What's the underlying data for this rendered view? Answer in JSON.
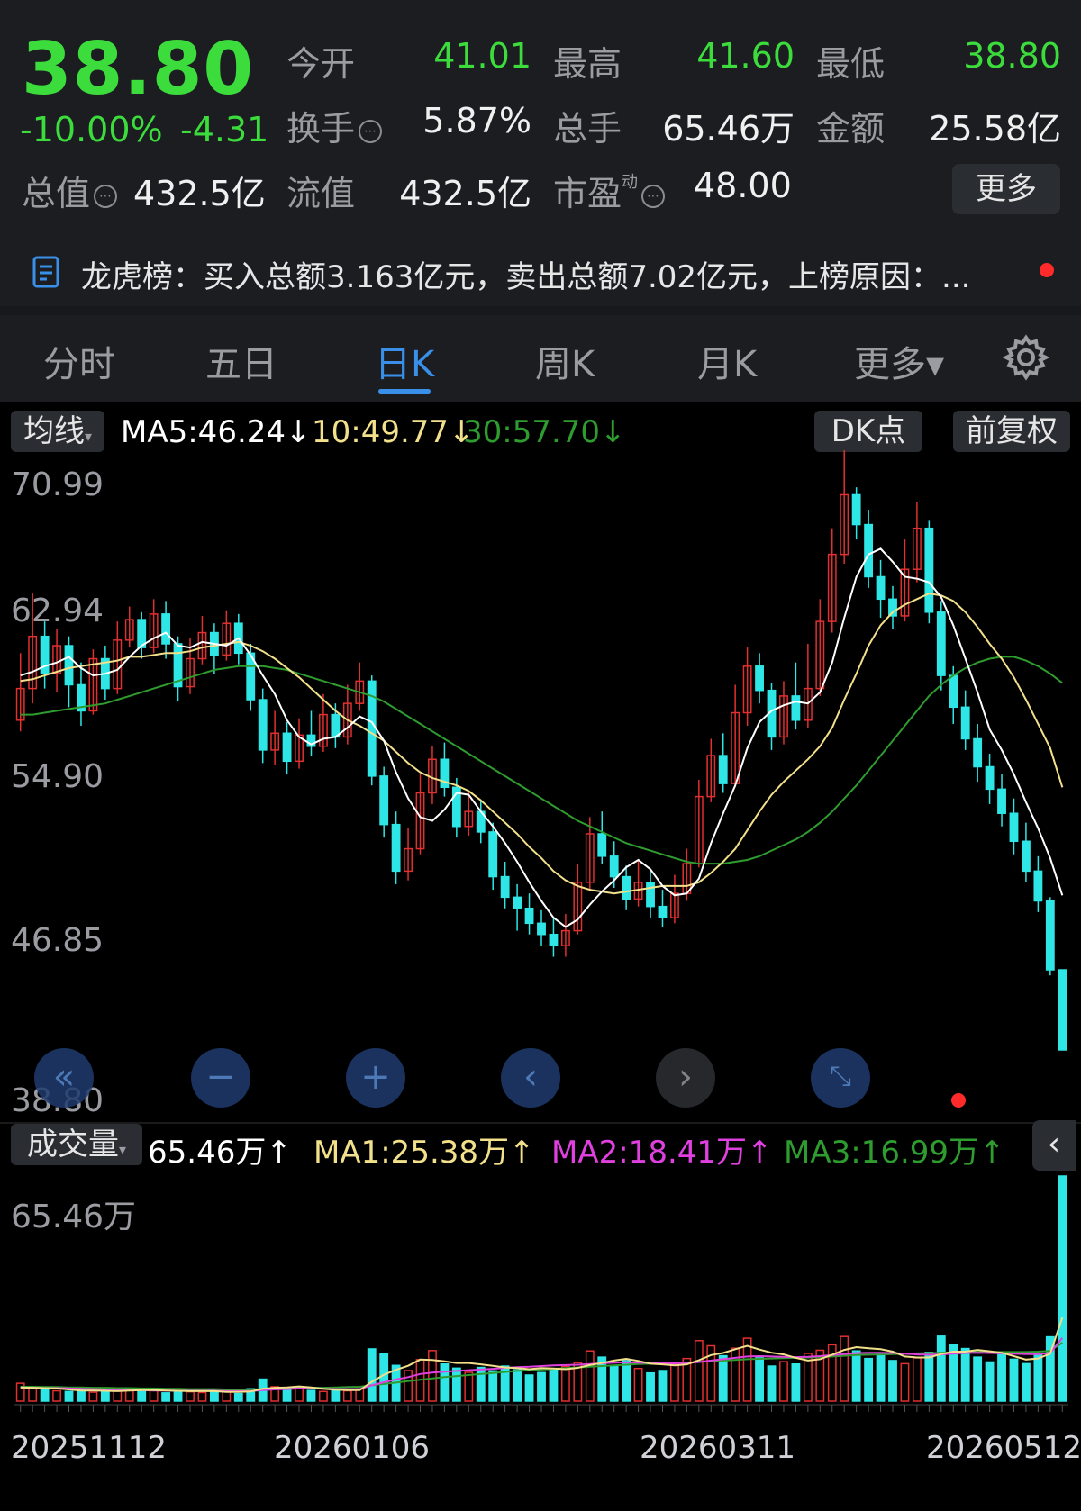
{
  "quote": {
    "price": "38.80",
    "change_pct": "-10.00%",
    "change_amt": "-4.31",
    "rows": [
      [
        {
          "label": "今开",
          "value": "41.01",
          "green": true
        },
        {
          "label": "最高",
          "value": "41.60",
          "green": true
        },
        {
          "label": "最低",
          "value": "38.80",
          "green": true
        }
      ],
      [
        {
          "label": "换手",
          "value": "5.87%"
        },
        {
          "label": "总手",
          "value": "65.46万"
        },
        {
          "label": "金额",
          "value": "25.58亿"
        }
      ]
    ],
    "row3": {
      "l1": "总值",
      "v1": "432.5亿",
      "l2": "流值",
      "v2": "432.5亿",
      "l3": "市盈",
      "l3_sup": "动",
      "v3": "48.00"
    },
    "more_label": "更多",
    "info_glyph": "⋯"
  },
  "notice": {
    "icon": "document-icon",
    "text": "龙虎榜：买入总额3.163亿元，卖出总额7.02亿元，上榜原因：...",
    "dot_color": "#ff2a2a"
  },
  "tabs": [
    {
      "label": "分时"
    },
    {
      "label": "五日"
    },
    {
      "label": "日K",
      "active": true
    },
    {
      "label": "周K"
    },
    {
      "label": "月K"
    },
    {
      "label": "更多▾"
    }
  ],
  "ma_bar": {
    "selector": "均线",
    "ma5": "MA5:46.24",
    "ma10": "10:49.77",
    "ma30": "30:57.70",
    "arrow": "↓",
    "dk": "DK点",
    "fq": "前复权"
  },
  "price_axis": [
    "70.99",
    "62.94",
    "54.90",
    "46.85",
    "38.80"
  ],
  "vol_bar": {
    "selector": "成交量",
    "vol": "65.46万",
    "ma1": "MA1:25.38万",
    "ma2": "MA2:18.41万",
    "ma3": "MA3:16.99万",
    "arrow": "↑",
    "max_label": "65.46万"
  },
  "dates": [
    "20251112",
    "20260106",
    "20260311",
    "20260512"
  ],
  "colors": {
    "up": "#e03030",
    "down": "#2ee6e6",
    "ma5": "#ffffff",
    "ma10": "#f2e08a",
    "ma30": "#2e9c2e",
    "vma1": "#f2e08a",
    "vma2": "#e040e0",
    "vma3": "#2e9c2e"
  },
  "chart_data": {
    "type": "candlestick",
    "ylim": [
      38.8,
      70.99
    ],
    "candles": [
      [
        56.5,
        58.2,
        60.1,
        55.9
      ],
      [
        58.2,
        61.0,
        63.3,
        57.4
      ],
      [
        61.0,
        59.0,
        61.8,
        58.2
      ],
      [
        59.0,
        60.5,
        61.4,
        58.0
      ],
      [
        60.5,
        58.4,
        61.0,
        57.2
      ],
      [
        58.4,
        57.0,
        59.6,
        56.2
      ],
      [
        57.0,
        59.8,
        60.3,
        56.8
      ],
      [
        59.8,
        58.2,
        60.5,
        57.6
      ],
      [
        58.2,
        60.8,
        61.8,
        57.9
      ],
      [
        60.8,
        61.9,
        62.6,
        60.4
      ],
      [
        61.9,
        60.4,
        62.3,
        59.8
      ],
      [
        60.4,
        62.2,
        63.0,
        60.1
      ],
      [
        62.2,
        60.6,
        62.9,
        59.8
      ],
      [
        60.6,
        58.3,
        61.0,
        57.5
      ],
      [
        58.3,
        59.8,
        60.9,
        57.9
      ],
      [
        59.8,
        61.2,
        62.1,
        59.5
      ],
      [
        61.2,
        60.0,
        61.7,
        59.0
      ],
      [
        60.0,
        61.7,
        62.4,
        59.7
      ],
      [
        61.7,
        60.1,
        62.2,
        59.5
      ],
      [
        60.1,
        57.6,
        60.6,
        57.0
      ],
      [
        57.6,
        54.9,
        58.2,
        54.2
      ],
      [
        54.9,
        55.8,
        57.0,
        54.1
      ],
      [
        55.8,
        54.3,
        56.4,
        53.6
      ],
      [
        54.3,
        55.7,
        56.6,
        53.9
      ],
      [
        55.7,
        55.1,
        57.0,
        54.6
      ],
      [
        55.1,
        56.8,
        57.9,
        54.8
      ],
      [
        56.8,
        55.6,
        57.4,
        55.0
      ],
      [
        55.6,
        57.4,
        58.4,
        55.2
      ],
      [
        57.4,
        58.6,
        59.6,
        57.0
      ],
      [
        58.6,
        53.5,
        58.9,
        53.0
      ],
      [
        53.5,
        50.9,
        54.0,
        50.2
      ],
      [
        50.9,
        48.4,
        51.6,
        47.7
      ],
      [
        48.4,
        49.6,
        50.7,
        47.9
      ],
      [
        49.6,
        52.6,
        53.6,
        49.3
      ],
      [
        52.6,
        54.4,
        55.1,
        52.0
      ],
      [
        54.4,
        52.9,
        55.3,
        52.4
      ],
      [
        52.9,
        50.8,
        53.4,
        50.2
      ],
      [
        50.8,
        51.6,
        52.7,
        50.3
      ],
      [
        51.6,
        50.5,
        52.2,
        49.9
      ],
      [
        50.5,
        48.1,
        51.0,
        47.4
      ],
      [
        48.1,
        47.0,
        48.9,
        46.4
      ],
      [
        47.0,
        46.4,
        47.7,
        45.2
      ],
      [
        46.4,
        45.6,
        47.2,
        45.0
      ],
      [
        45.6,
        45.0,
        46.3,
        44.4
      ],
      [
        45.0,
        44.4,
        45.9,
        43.8
      ],
      [
        44.4,
        45.2,
        46.1,
        43.8
      ],
      [
        45.2,
        47.8,
        48.8,
        45.0
      ],
      [
        47.8,
        50.4,
        51.3,
        47.4
      ],
      [
        50.4,
        49.2,
        51.6,
        48.8
      ],
      [
        49.2,
        48.1,
        50.0,
        47.5
      ],
      [
        48.1,
        46.9,
        48.7,
        46.3
      ],
      [
        46.9,
        47.8,
        49.0,
        46.5
      ],
      [
        47.8,
        46.5,
        48.5,
        45.9
      ],
      [
        46.5,
        45.9,
        47.4,
        45.4
      ],
      [
        45.9,
        47.2,
        48.2,
        45.6
      ],
      [
        47.2,
        48.8,
        49.6,
        46.8
      ],
      [
        48.8,
        52.4,
        53.3,
        48.6
      ],
      [
        52.4,
        54.6,
        55.5,
        52.1
      ],
      [
        54.6,
        53.1,
        55.8,
        52.6
      ],
      [
        53.1,
        56.9,
        58.4,
        52.9
      ],
      [
        56.9,
        59.4,
        60.4,
        56.2
      ],
      [
        59.4,
        58.1,
        60.1,
        57.4
      ],
      [
        58.1,
        55.6,
        58.5,
        54.9
      ],
      [
        55.6,
        57.8,
        58.6,
        55.2
      ],
      [
        57.8,
        56.5,
        59.6,
        56.0
      ],
      [
        56.5,
        58.2,
        60.6,
        56.1
      ],
      [
        58.2,
        61.8,
        63.0,
        57.8
      ],
      [
        61.8,
        65.4,
        66.8,
        61.2
      ],
      [
        65.4,
        68.6,
        70.99,
        64.9
      ],
      [
        68.6,
        67.0,
        69.0,
        66.2
      ],
      [
        67.0,
        64.2,
        67.8,
        63.6
      ],
      [
        64.2,
        63.0,
        65.1,
        62.0
      ],
      [
        63.0,
        62.1,
        63.7,
        61.4
      ],
      [
        62.1,
        64.6,
        66.2,
        61.8
      ],
      [
        64.6,
        66.8,
        68.2,
        63.9
      ],
      [
        66.8,
        62.3,
        67.2,
        61.7
      ],
      [
        62.3,
        58.9,
        62.9,
        58.1
      ],
      [
        58.9,
        57.2,
        59.4,
        56.3
      ],
      [
        57.2,
        55.5,
        58.1,
        54.9
      ],
      [
        55.5,
        54.0,
        56.3,
        53.2
      ],
      [
        54.0,
        52.8,
        54.7,
        52.0
      ],
      [
        52.8,
        51.5,
        53.6,
        50.8
      ],
      [
        51.5,
        50.0,
        52.3,
        49.3
      ],
      [
        50.0,
        48.4,
        51.0,
        47.8
      ],
      [
        48.4,
        46.8,
        49.2,
        46.2
      ],
      [
        46.8,
        43.1,
        47.0,
        42.8
      ],
      [
        43.1,
        38.8,
        41.6,
        38.8
      ]
    ],
    "ma5": [
      58.9,
      59.1,
      59.4,
      59.6,
      59.9,
      59.3,
      58.9,
      59.0,
      59.2,
      59.9,
      60.5,
      60.9,
      61.2,
      60.5,
      60.4,
      60.7,
      60.6,
      60.5,
      60.9,
      60.0,
      58.9,
      57.9,
      56.5,
      55.6,
      55.2,
      55.5,
      55.6,
      56.1,
      56.7,
      56.4,
      55.4,
      53.7,
      52.3,
      51.3,
      51.1,
      51.7,
      52.6,
      52.5,
      51.6,
      50.8,
      49.9,
      48.9,
      47.8,
      46.8,
      45.9,
      45.4,
      45.8,
      46.6,
      47.3,
      47.9,
      48.6,
      49.0,
      48.5,
      47.6,
      47.1,
      47.2,
      48.0,
      49.9,
      51.5,
      53.0,
      55.0,
      56.4,
      57.0,
      57.3,
      57.5,
      57.4,
      58.0,
      59.6,
      62.0,
      64.2,
      65.4,
      65.7,
      65.0,
      64.2,
      64.1,
      63.9,
      63.1,
      61.6,
      59.8,
      58.0,
      56.0,
      54.9,
      53.6,
      52.1,
      50.7,
      49.1,
      47.1
    ],
    "ma10": [
      58.6,
      58.7,
      58.9,
      59.1,
      59.3,
      59.4,
      59.5,
      59.6,
      59.7,
      59.9,
      59.9,
      60.0,
      60.1,
      60.1,
      60.2,
      60.4,
      60.5,
      60.6,
      60.7,
      60.5,
      60.2,
      59.8,
      59.3,
      58.8,
      58.2,
      57.6,
      57.0,
      56.5,
      56.2,
      55.8,
      55.4,
      54.8,
      54.2,
      53.7,
      53.4,
      53.2,
      53.0,
      52.7,
      52.2,
      51.6,
      51.0,
      50.4,
      49.7,
      49.1,
      48.4,
      47.9,
      47.6,
      47.4,
      47.3,
      47.2,
      47.3,
      47.4,
      47.5,
      47.6,
      47.6,
      47.6,
      47.8,
      48.3,
      48.9,
      49.6,
      50.6,
      51.6,
      52.5,
      53.2,
      53.8,
      54.4,
      55.1,
      56.1,
      57.6,
      59.0,
      60.5,
      61.6,
      62.3,
      62.7,
      63.0,
      63.3,
      63.2,
      62.9,
      62.3,
      61.5,
      60.6,
      59.8,
      58.8,
      57.6,
      56.3,
      55.0,
      52.9
    ],
    "ma30": [
      56.8,
      56.8,
      56.9,
      57.0,
      57.1,
      57.2,
      57.3,
      57.4,
      57.6,
      57.8,
      58.0,
      58.2,
      58.4,
      58.6,
      58.8,
      59.0,
      59.2,
      59.3,
      59.4,
      59.4,
      59.4,
      59.3,
      59.2,
      59.0,
      58.8,
      58.6,
      58.4,
      58.2,
      58.0,
      57.8,
      57.5,
      57.1,
      56.7,
      56.3,
      55.9,
      55.5,
      55.1,
      54.7,
      54.3,
      53.9,
      53.5,
      53.1,
      52.7,
      52.3,
      51.9,
      51.5,
      51.1,
      50.8,
      50.5,
      50.2,
      49.9,
      49.7,
      49.5,
      49.3,
      49.1,
      48.9,
      48.8,
      48.8,
      48.8,
      48.9,
      49.0,
      49.2,
      49.5,
      49.8,
      50.1,
      50.5,
      51.0,
      51.6,
      52.3,
      53.0,
      53.8,
      54.6,
      55.4,
      56.2,
      57.0,
      57.8,
      58.4,
      58.9,
      59.3,
      59.6,
      59.8,
      59.9,
      59.9,
      59.7,
      59.4,
      59.0,
      58.5
    ],
    "volume": [
      5.2,
      4.1,
      3.6,
      3.0,
      2.8,
      3.3,
      2.6,
      2.9,
      3.4,
      3.7,
      2.9,
      3.2,
      2.4,
      3.1,
      2.7,
      2.5,
      3.0,
      2.8,
      2.2,
      3.6,
      6.4,
      4.2,
      3.5,
      3.9,
      3.1,
      2.8,
      3.3,
      3.0,
      3.6,
      15.2,
      13.8,
      10.4,
      8.9,
      12.1,
      14.7,
      10.8,
      9.6,
      8.4,
      9.8,
      8.8,
      10.2,
      9.1,
      7.6,
      8.3,
      9.4,
      10.1,
      11.2,
      14.6,
      12.8,
      10.4,
      11.8,
      9.5,
      8.2,
      8.9,
      10.6,
      12.4,
      17.6,
      16.1,
      13.2,
      15.4,
      18.3,
      12.6,
      10.2,
      11.5,
      10.8,
      13.9,
      14.8,
      16.4,
      18.8,
      14.6,
      12.4,
      13.9,
      11.8,
      10.9,
      12.6,
      14.2,
      18.9,
      16.4,
      15.3,
      12.8,
      11.4,
      13.6,
      12.2,
      10.9,
      13.8,
      18.7,
      65.46
    ],
    "vol_ma1": [
      4.0,
      3.9,
      3.8,
      3.7,
      3.4,
      3.1,
      3.1,
      3.0,
      2.9,
      3.1,
      3.2,
      3.2,
      3.1,
      3.0,
      2.9,
      2.9,
      2.9,
      2.7,
      2.7,
      2.8,
      3.6,
      3.9,
      4.0,
      4.3,
      4.0,
      3.6,
      3.3,
      3.2,
      3.2,
      5.6,
      7.7,
      9.1,
      10.3,
      12.1,
      12.0,
      11.6,
      11.1,
      11.1,
      10.7,
      10.3,
      9.8,
      9.6,
      9.3,
      9.6,
      9.5,
      9.3,
      9.7,
      10.5,
      11.1,
      11.8,
      12.3,
      11.7,
      10.9,
      10.7,
      10.4,
      10.7,
      11.9,
      13.4,
      14.0,
      15.1,
      16.1,
      15.0,
      14.1,
      13.6,
      12.6,
      11.8,
      12.2,
      13.5,
      14.9,
      15.7,
      15.4,
      15.1,
      14.4,
      13.0,
      12.7,
      12.7,
      13.7,
      14.4,
      14.4,
      14.9,
      14.5,
      14.1,
      13.1,
      12.1,
      12.4,
      13.8,
      24.3
    ],
    "vol_ma2": [
      3.9,
      3.9,
      3.8,
      3.8,
      3.7,
      3.6,
      3.5,
      3.4,
      3.3,
      3.3,
      3.2,
      3.1,
      3.1,
      3.0,
      3.0,
      3.0,
      3.0,
      2.9,
      2.9,
      2.9,
      3.2,
      3.4,
      3.5,
      3.7,
      3.7,
      3.6,
      3.5,
      3.5,
      3.5,
      4.6,
      5.5,
      6.3,
      7.0,
      7.9,
      8.3,
      8.6,
      8.8,
      9.0,
      9.2,
      9.4,
      9.7,
      9.9,
      10.0,
      10.2,
      10.4,
      10.5,
      10.6,
      10.8,
      11.0,
      11.2,
      11.3,
      11.2,
      11.1,
      11.0,
      11.0,
      11.1,
      11.4,
      11.8,
      12.2,
      12.6,
      13.0,
      13.1,
      13.0,
      12.9,
      12.8,
      12.9,
      13.1,
      13.4,
      13.7,
      14.0,
      14.1,
      14.1,
      14.0,
      13.8,
      13.6,
      13.5,
      13.6,
      13.8,
      14.0,
      14.1,
      14.0,
      13.9,
      13.8,
      13.7,
      13.7,
      14.0,
      18.4
    ],
    "vol_ma3": [
      4.2,
      4.2,
      4.1,
      4.1,
      4.0,
      4.0,
      3.9,
      3.9,
      3.8,
      3.8,
      3.7,
      3.7,
      3.6,
      3.6,
      3.5,
      3.5,
      3.5,
      3.4,
      3.4,
      3.4,
      3.5,
      3.6,
      3.7,
      3.8,
      3.9,
      3.9,
      4.0,
      4.1,
      4.2,
      4.6,
      5.0,
      5.4,
      5.8,
      6.2,
      6.6,
      7.0,
      7.3,
      7.6,
      7.9,
      8.2,
      8.5,
      8.8,
      9.0,
      9.2,
      9.4,
      9.6,
      9.8,
      10.0,
      10.2,
      10.4,
      10.6,
      10.8,
      10.9,
      11.0,
      11.1,
      11.2,
      11.4,
      11.6,
      11.8,
      12.0,
      12.2,
      12.3,
      12.4,
      12.5,
      12.6,
      12.7,
      12.8,
      13.0,
      13.2,
      13.4,
      13.5,
      13.6,
      13.7,
      13.8,
      13.9,
      14.0,
      14.1,
      14.2,
      14.3,
      14.3,
      14.3,
      14.3,
      14.3,
      14.3,
      14.4,
      14.6,
      17.0
    ],
    "vol_ylim": [
      0,
      65.46
    ]
  }
}
